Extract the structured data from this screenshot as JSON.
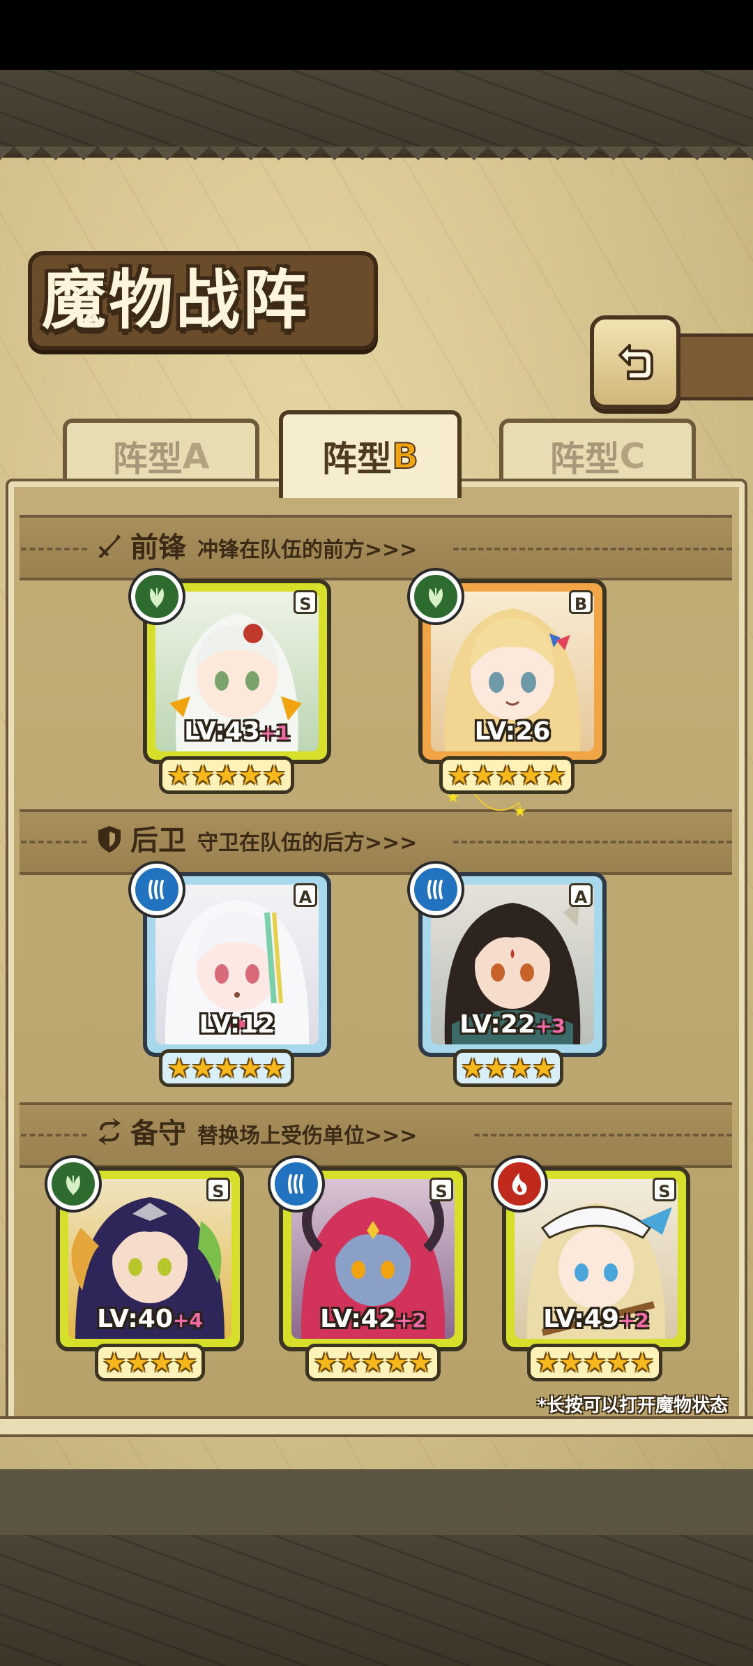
{
  "title": "魔物战阵",
  "tabs": [
    {
      "label": "阵型",
      "key": "A",
      "active": false
    },
    {
      "label": "阵型",
      "key": "B",
      "active": true
    },
    {
      "label": "阵型",
      "key": "C",
      "active": false
    }
  ],
  "sections": {
    "front": {
      "title": "前锋",
      "subtitle": "冲锋在队伍的前方>>>",
      "icon": "sword-icon"
    },
    "back": {
      "title": "后卫",
      "subtitle": "守卫在队伍的后方>>>",
      "icon": "shield-icon"
    },
    "reserve": {
      "title": "备守",
      "subtitle": "替换场上受伤单位>>>",
      "icon": "swap-icon"
    }
  },
  "units": {
    "front1": {
      "rank": "S",
      "element": "leaf-icon",
      "level": "LV:43",
      "plus": "+1",
      "stars": 5
    },
    "front2": {
      "rank": "B",
      "element": "leaf-icon",
      "level": "LV:26",
      "plus": "",
      "stars": 5
    },
    "back1": {
      "rank": "A",
      "element": "water-icon",
      "level": "LV:12",
      "plus": "",
      "stars": 5
    },
    "back2": {
      "rank": "A",
      "element": "water-icon",
      "level": "LV:22",
      "plus": "+3",
      "stars": 4
    },
    "res1": {
      "rank": "S",
      "element": "leaf-icon",
      "level": "LV:40",
      "plus": "+4",
      "stars": 4
    },
    "res2": {
      "rank": "S",
      "element": "water-icon",
      "level": "LV:42",
      "plus": "+2",
      "stars": 5
    },
    "res3": {
      "rank": "S",
      "element": "fire-icon",
      "level": "LV:49",
      "plus": "+2",
      "stars": 5
    }
  },
  "hint": "*长按可以打开魔物状态",
  "colors": {
    "accent": "#f1a410",
    "parchment": "#cdbb86",
    "ink": "#3b2a16"
  }
}
